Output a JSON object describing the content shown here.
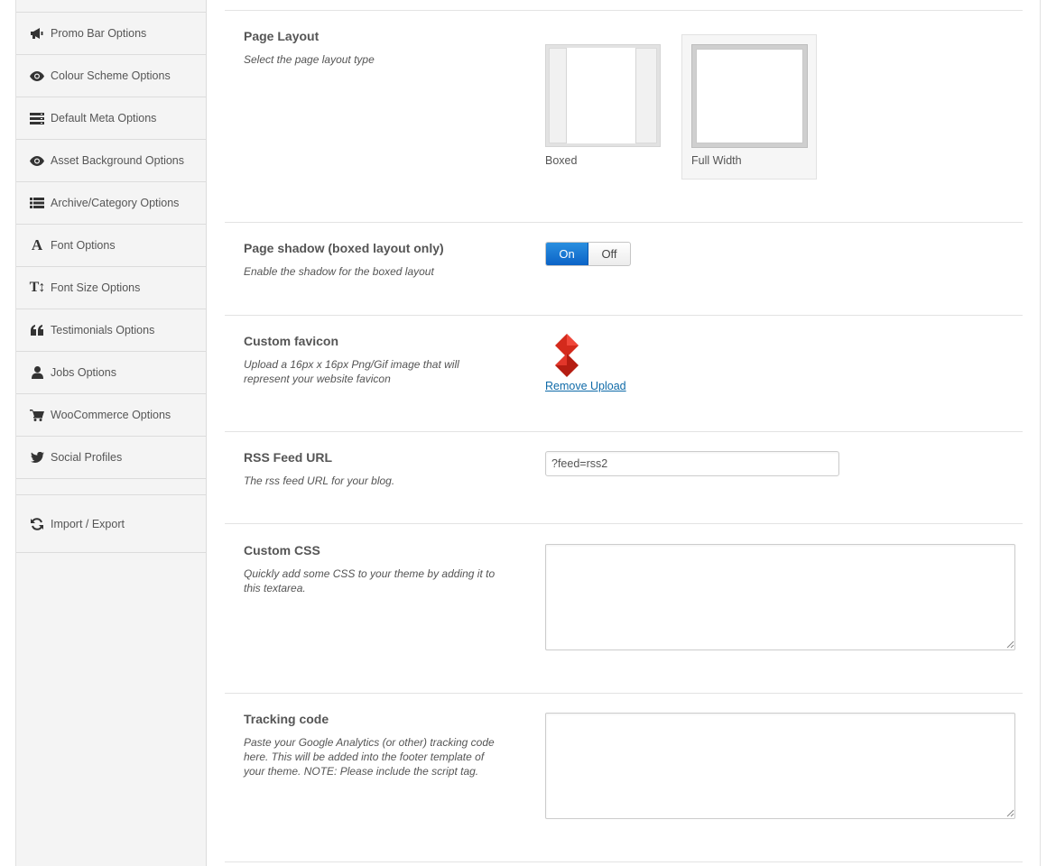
{
  "sidebar": {
    "items": [
      {
        "label": "Promo Bar Options",
        "icon": "megaphone-icon"
      },
      {
        "label": "Colour Scheme Options",
        "icon": "eye-icon"
      },
      {
        "label": "Default Meta Options",
        "icon": "stack-icon"
      },
      {
        "label": "Asset Background Options",
        "icon": "eye-icon"
      },
      {
        "label": "Archive/Category Options",
        "icon": "list-icon"
      },
      {
        "label": "Font Options",
        "icon": "font-icon"
      },
      {
        "label": "Font Size Options",
        "icon": "text-height-icon"
      },
      {
        "label": "Testimonials Options",
        "icon": "quote-icon"
      },
      {
        "label": "Jobs Options",
        "icon": "user-icon"
      },
      {
        "label": "WooCommerce Options",
        "icon": "cart-icon"
      },
      {
        "label": "Social Profiles",
        "icon": "twitter-icon"
      },
      {
        "label": "Import / Export",
        "icon": "refresh-icon"
      }
    ]
  },
  "options": {
    "page_layout": {
      "title": "Page Layout",
      "desc": "Select the page layout type",
      "choices": [
        "Boxed",
        "Full Width"
      ],
      "selected": "Full Width"
    },
    "page_shadow": {
      "title": "Page shadow (boxed layout only)",
      "desc": "Enable the shadow for the boxed layout",
      "on_label": "On",
      "off_label": "Off",
      "state": "On"
    },
    "favicon": {
      "title": "Custom favicon",
      "desc": "Upload a 16px x 16px Png/Gif image that will represent your website favicon",
      "remove_label": "Remove Upload"
    },
    "rss": {
      "title": "RSS Feed URL",
      "desc": "The rss feed URL for your blog.",
      "value": "?feed=rss2"
    },
    "custom_css": {
      "title": "Custom CSS",
      "desc": "Quickly add some CSS to your theme by adding it to this textarea.",
      "value": ""
    },
    "tracking": {
      "title": "Tracking code",
      "desc": "Paste your Google Analytics (or other) tracking code here. This will be added into the footer template of your theme. NOTE: Please include the script tag.",
      "value": ""
    }
  },
  "colors": {
    "toggle_on": "#0b63c7",
    "link": "#0e6aa8",
    "favicon_red": "#d42a1c"
  }
}
